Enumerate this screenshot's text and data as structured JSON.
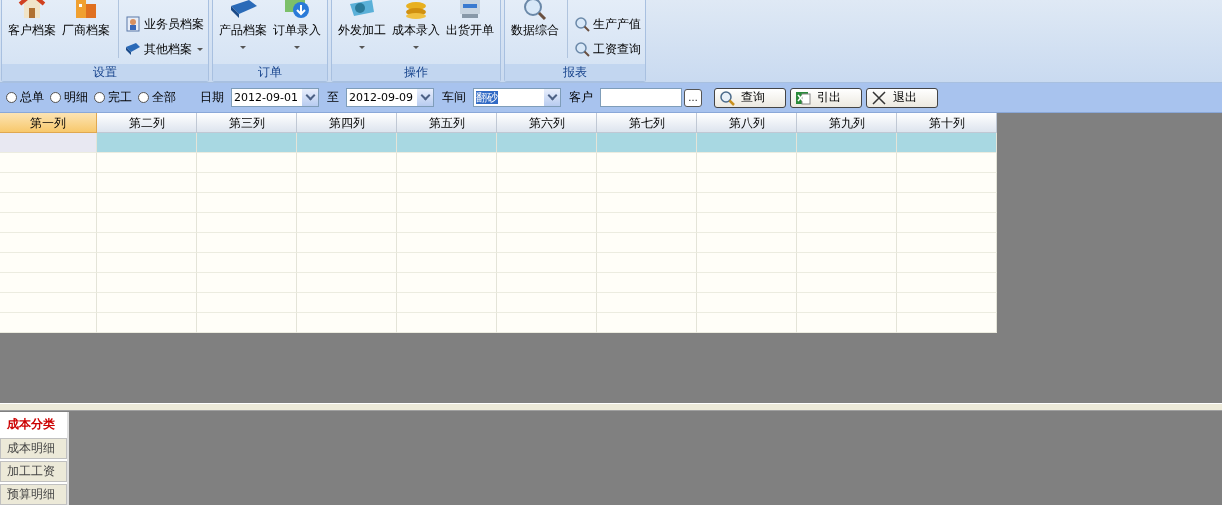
{
  "ribbon": {
    "groups": [
      {
        "label": "设置",
        "large": [
          {
            "label": "客户档案",
            "dropdown": false
          },
          {
            "label": "厂商档案",
            "dropdown": false
          }
        ],
        "small": [
          {
            "label": "业务员档案",
            "dropdown": false
          },
          {
            "label": "其他档案",
            "dropdown": true
          }
        ]
      },
      {
        "label": "订单",
        "large": [
          {
            "label": "产品档案",
            "dropdown": true
          },
          {
            "label": "订单录入",
            "dropdown": true
          }
        ]
      },
      {
        "label": "操作",
        "large": [
          {
            "label": "外发加工",
            "dropdown": true
          },
          {
            "label": "成本录入",
            "dropdown": true
          },
          {
            "label": "出货开单",
            "dropdown": false
          }
        ]
      },
      {
        "label": "报表",
        "large": [
          {
            "label": "数据综合",
            "dropdown": false
          }
        ],
        "small": [
          {
            "label": "生产产值",
            "dropdown": false
          },
          {
            "label": "工资查询",
            "dropdown": false
          }
        ]
      }
    ]
  },
  "filter": {
    "radios": [
      {
        "label": "总单",
        "selected": false
      },
      {
        "label": "明细",
        "selected": false
      },
      {
        "label": "完工",
        "selected": false
      },
      {
        "label": "全部",
        "selected": false
      }
    ],
    "date_label": "日期",
    "date_from": "2012-09-01",
    "to_label": "至",
    "date_to": "2012-09-09",
    "workshop_label": "车间",
    "workshop": "翻砂",
    "customer_label": "客户",
    "browse_button": "…",
    "buttons": [
      "查询",
      "引出",
      "退出"
    ]
  },
  "table": {
    "columns": [
      {
        "label": "第一列",
        "selected": true
      },
      {
        "label": "第二列",
        "selected": false
      },
      {
        "label": "第三列",
        "selected": false
      },
      {
        "label": "第四列",
        "selected": false
      },
      {
        "label": "第五列",
        "selected": false
      },
      {
        "label": "第六列",
        "selected": false
      },
      {
        "label": "第七列",
        "selected": false
      },
      {
        "label": "第八列",
        "selected": false
      },
      {
        "label": "第九列",
        "selected": false
      },
      {
        "label": "第十列",
        "selected": false
      }
    ],
    "rows": [
      {
        "selected": true
      },
      {
        "selected": false
      },
      {
        "selected": false
      },
      {
        "selected": false
      },
      {
        "selected": false
      },
      {
        "selected": false
      },
      {
        "selected": false
      },
      {
        "selected": false
      },
      {
        "selected": false
      },
      {
        "selected": false
      }
    ]
  },
  "bottom_tabs": [
    {
      "label": "成本分类",
      "selected": true
    },
    {
      "label": "成本明细",
      "selected": false
    },
    {
      "label": "加工工资",
      "selected": false
    },
    {
      "label": "预算明细",
      "selected": false
    }
  ]
}
